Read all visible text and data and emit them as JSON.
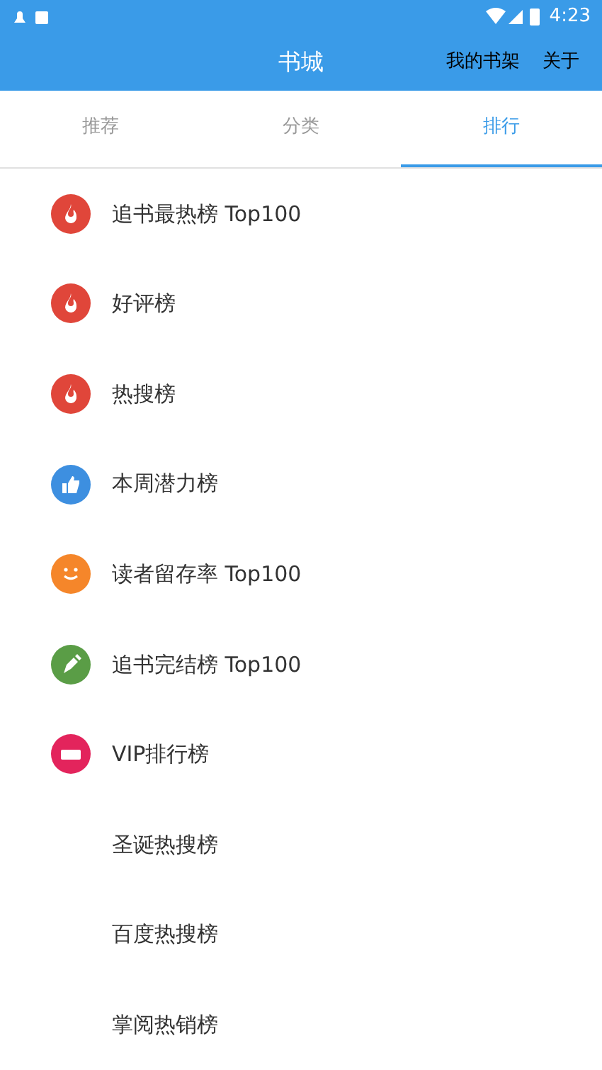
{
  "status_bar": {
    "time": "4:23"
  },
  "app_bar": {
    "title": "书城",
    "actions": [
      "我的书架",
      "关于"
    ]
  },
  "tabs": [
    {
      "label": "推荐",
      "selected": false
    },
    {
      "label": "分类",
      "selected": false
    },
    {
      "label": "排行",
      "selected": true
    }
  ],
  "rankings": [
    {
      "label": "追书最热榜 Top100",
      "kind": "fire",
      "color": "#e0463a"
    },
    {
      "label": "好评榜",
      "kind": "fire",
      "color": "#e0463a"
    },
    {
      "label": "热搜榜",
      "kind": "fire",
      "color": "#e0463a"
    },
    {
      "label": "本周潜力榜",
      "kind": "thumb",
      "color": "#3d8fe0"
    },
    {
      "label": "读者留存率 Top100",
      "kind": "smile",
      "color": "#f5862a"
    },
    {
      "label": "追书完结榜 Top100",
      "kind": "pen",
      "color": "#5a9d46"
    },
    {
      "label": "VIP排行榜",
      "kind": "ticket",
      "color": "#e3245c"
    },
    {
      "label": "圣诞热搜榜",
      "kind": "none"
    },
    {
      "label": "百度热搜榜",
      "kind": "none"
    },
    {
      "label": "掌阅热销榜",
      "kind": "none"
    }
  ]
}
